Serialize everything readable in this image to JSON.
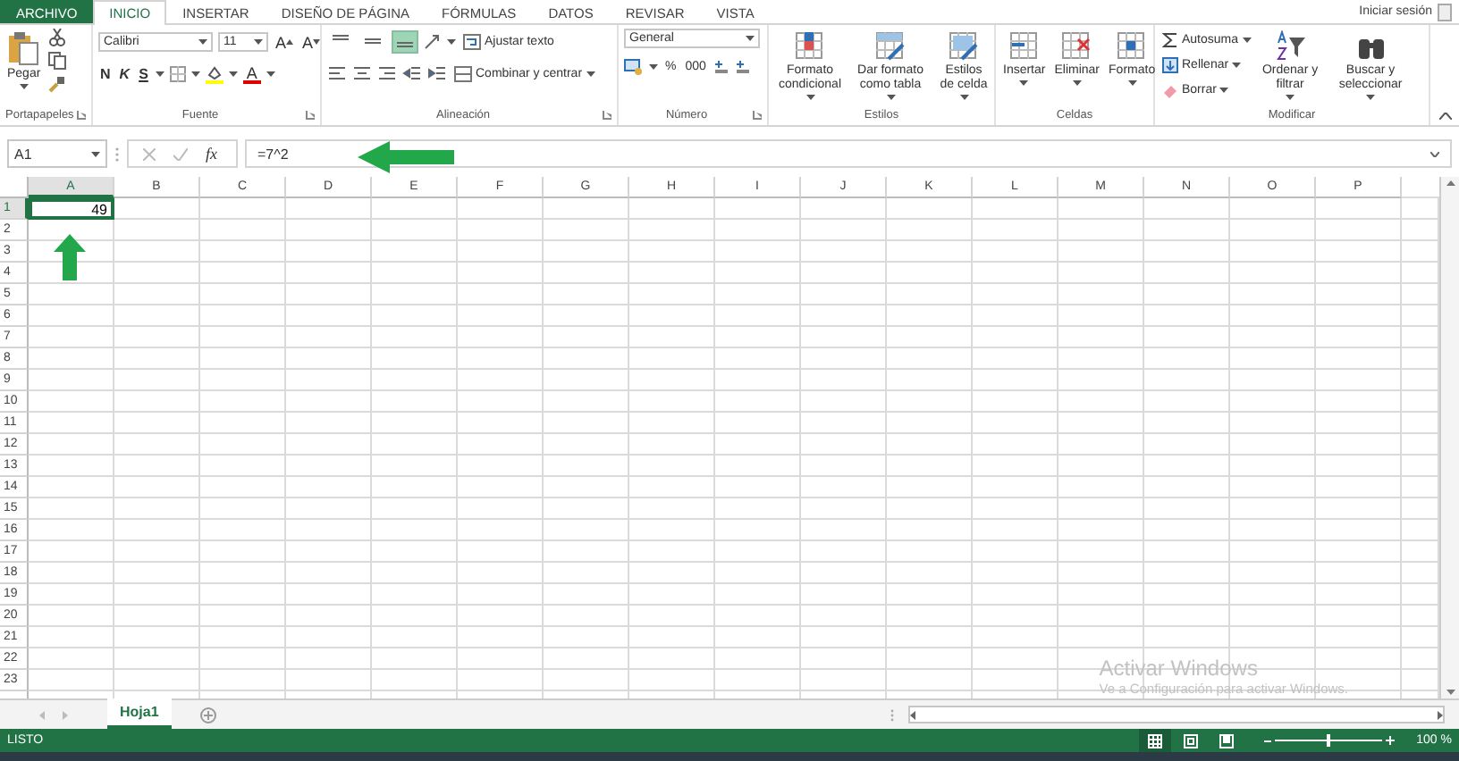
{
  "menu_tabs": [
    {
      "label": "ARCHIVO",
      "kind": "file",
      "selected": false
    },
    {
      "label": "INICIO",
      "kind": "tab",
      "selected": true
    },
    {
      "label": "INSERTAR",
      "kind": "tab",
      "selected": false
    },
    {
      "label": "DISEÑO DE PÁGINA",
      "kind": "tab",
      "selected": false
    },
    {
      "label": "FÓRMULAS",
      "kind": "tab",
      "selected": false
    },
    {
      "label": "DATOS",
      "kind": "tab",
      "selected": false
    },
    {
      "label": "REVISAR",
      "kind": "tab",
      "selected": false
    },
    {
      "label": "VISTA",
      "kind": "tab",
      "selected": false
    }
  ],
  "account": "Iniciar sesión",
  "ribbon": {
    "clipboard": {
      "label": "Portapapeles",
      "paste": "Pegar"
    },
    "font": {
      "label": "Fuente",
      "font_name": "Calibri",
      "font_size": "11",
      "size_buttons": [
        "A",
        "A"
      ],
      "style_buttons": [
        "N",
        "K",
        "S"
      ],
      "font_color": "A"
    },
    "alignment": {
      "label": "Alineación",
      "vertical_align": [
        {
          "selected": false
        },
        {
          "selected": false
        },
        {
          "selected": true
        }
      ],
      "wrap": "Ajustar texto",
      "merge": "Combinar y centrar"
    },
    "number": {
      "label": "Número",
      "format": "General",
      "buttons": [
        "%",
        "000"
      ]
    },
    "styles": {
      "label": "Estilos",
      "buttons": [
        "Formato condicional",
        "Dar formato como tabla",
        "Estilos de celda"
      ]
    },
    "cells": {
      "label": "Celdas",
      "buttons": [
        "Insertar",
        "Eliminar",
        "Formato"
      ]
    },
    "editing": {
      "label": "Modificar",
      "small_buttons": [
        "Autosuma",
        "Rellenar",
        "Borrar"
      ],
      "big_buttons": [
        "Ordenar y filtrar",
        "Buscar y seleccionar"
      ]
    }
  },
  "formula_bar": {
    "name_box": "A1",
    "fx": "fx",
    "formula": "=7^2"
  },
  "sheet": {
    "columns": [
      {
        "label": "A",
        "selected": true
      },
      {
        "label": "B",
        "selected": false
      },
      {
        "label": "C",
        "selected": false
      },
      {
        "label": "D",
        "selected": false
      },
      {
        "label": "E",
        "selected": false
      },
      {
        "label": "F",
        "selected": false
      },
      {
        "label": "G",
        "selected": false
      },
      {
        "label": "H",
        "selected": false
      },
      {
        "label": "I",
        "selected": false
      },
      {
        "label": "J",
        "selected": false
      },
      {
        "label": "K",
        "selected": false
      },
      {
        "label": "L",
        "selected": false
      },
      {
        "label": "M",
        "selected": false
      },
      {
        "label": "N",
        "selected": false
      },
      {
        "label": "O",
        "selected": false
      },
      {
        "label": "P",
        "selected": false
      }
    ],
    "rows": [
      {
        "label": "1",
        "selected": true,
        "cells": [
          "49"
        ]
      },
      {
        "label": "2",
        "selected": false
      },
      {
        "label": "3",
        "selected": false
      },
      {
        "label": "4",
        "selected": false
      },
      {
        "label": "5",
        "selected": false
      },
      {
        "label": "6",
        "selected": false
      },
      {
        "label": "7",
        "selected": false
      },
      {
        "label": "8",
        "selected": false
      },
      {
        "label": "9",
        "selected": false
      },
      {
        "label": "10",
        "selected": false
      },
      {
        "label": "11",
        "selected": false
      },
      {
        "label": "12",
        "selected": false
      },
      {
        "label": "13",
        "selected": false
      },
      {
        "label": "14",
        "selected": false
      },
      {
        "label": "15",
        "selected": false
      },
      {
        "label": "16",
        "selected": false
      },
      {
        "label": "17",
        "selected": false
      },
      {
        "label": "18",
        "selected": false
      },
      {
        "label": "19",
        "selected": false
      },
      {
        "label": "20",
        "selected": false
      },
      {
        "label": "21",
        "selected": false
      },
      {
        "label": "22",
        "selected": false
      },
      {
        "label": "23",
        "selected": false
      }
    ]
  },
  "sheet_tabs": [
    {
      "label": "Hoja1",
      "selected": true
    }
  ],
  "os_notice": {
    "title": "Activar Windows",
    "text": "Ve a Configuración para activar Windows."
  },
  "status_bar": {
    "status": "LISTO",
    "views": [
      {
        "selected": true
      },
      {
        "selected": false
      },
      {
        "selected": false
      }
    ],
    "zoom": {
      "level": 0.5
    },
    "zoom_text": "100 %"
  }
}
